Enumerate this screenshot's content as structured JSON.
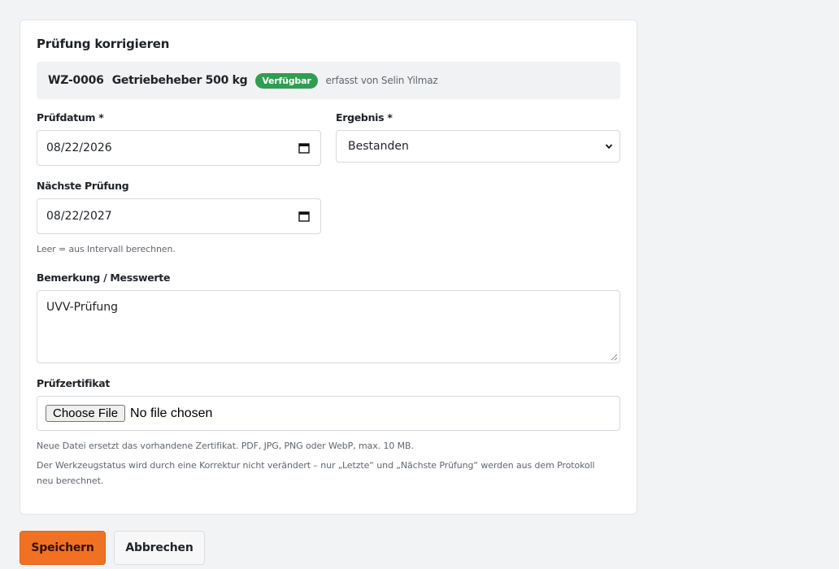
{
  "card": {
    "title": "Prüfung korrigieren",
    "tool": {
      "code": "WZ-0006",
      "name": "Getriebeheber 500 kg",
      "status_badge": "Verfügbar",
      "recorded_by": "erfasst von Selin Yilmaz"
    }
  },
  "form": {
    "pruefdatum": {
      "label": "Prüfdatum *",
      "value": "08/22/2026"
    },
    "ergebnis": {
      "label": "Ergebnis *",
      "value": "Bestanden"
    },
    "naechste": {
      "label": "Nächste Prüfung",
      "value": "08/22/2027",
      "hint": "Leer = aus Intervall berechnen."
    },
    "bemerkung": {
      "label": "Bemerkung / Messwerte",
      "value": "UVV-Prüfung"
    },
    "zertifikat": {
      "label": "Prüfzertifikat",
      "choose_label": "Choose File",
      "no_file": "No file chosen",
      "hint": "Neue Datei ersetzt das vorhandene Zertifikat. PDF, JPG, PNG oder WebP, max. 10 MB."
    },
    "status_note": "Der Werkzeugstatus wird durch eine Korrektur nicht verändert – nur „Letzte“ und „Nächste Prüfung“ werden aus dem Protokoll neu berechnet."
  },
  "actions": {
    "save": "Speichern",
    "cancel": "Abbrechen"
  },
  "colors": {
    "accent": "#f07121",
    "badge": "#2e9e4f"
  }
}
